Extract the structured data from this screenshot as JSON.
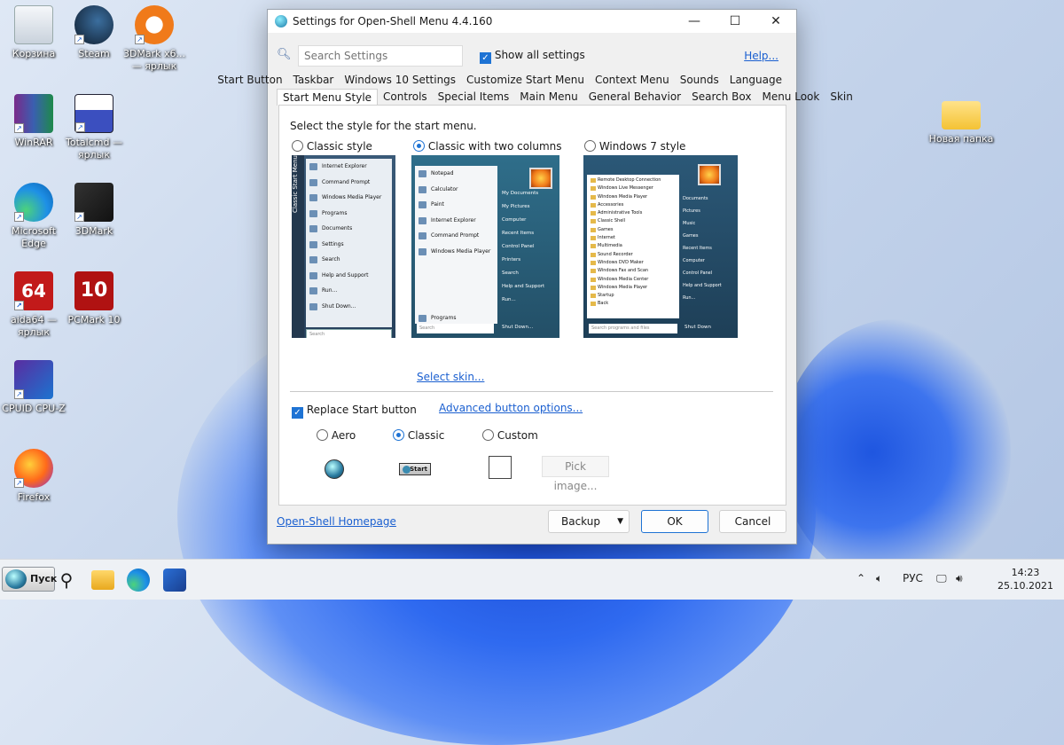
{
  "desktop": {
    "icons": [
      {
        "label": "Корзина"
      },
      {
        "label": "Steam"
      },
      {
        "label": "3DMark x6... — ярлык"
      },
      {
        "label": "WinRAR"
      },
      {
        "label": "Totalcmd — ярлык"
      },
      {
        "label": "Microsoft Edge"
      },
      {
        "label": "3DMark"
      },
      {
        "label": "aida64 — ярлык"
      },
      {
        "label": "PCMark 10"
      },
      {
        "label": "CPUID CPU-Z"
      },
      {
        "label": "Firefox"
      },
      {
        "label": "Новая папка"
      }
    ]
  },
  "window": {
    "title": "Settings for Open-Shell Menu 4.4.160",
    "search_placeholder": "Search Settings",
    "show_all_label": "Show all settings",
    "help_label": "Help...",
    "tabs_row1": [
      "Start Button",
      "Taskbar",
      "Windows 10 Settings",
      "Customize Start Menu",
      "Context Menu",
      "Sounds",
      "Language"
    ],
    "tabs_row2": [
      "Start Menu Style",
      "Controls",
      "Special Items",
      "Main Menu",
      "General Behavior",
      "Search Box",
      "Menu Look",
      "Skin"
    ],
    "select_label": "Select the style for the start menu.",
    "styles": [
      "Classic style",
      "Classic with two columns",
      "Windows 7 style"
    ],
    "preview_classic": {
      "side_text": "Classic Start Menu",
      "items": [
        "Internet Explorer",
        "Command Prompt",
        "Windows Media Player",
        "Programs",
        "Documents",
        "Settings",
        "Search",
        "Help and Support",
        "Run...",
        "Shut Down..."
      ],
      "search": "Search"
    },
    "preview_two_col": {
      "left": [
        "Notepad",
        "Calculator",
        "Paint",
        "Internet Explorer",
        "Command Prompt",
        "Windows Media Player"
      ],
      "programs": "Programs",
      "right": [
        "My Documents",
        "My Pictures",
        "Computer",
        "Recent Items",
        "Control Panel",
        "Printers",
        "Search",
        "Help and Support",
        "Run..."
      ],
      "search": "Search",
      "shutdown": "Shut Down..."
    },
    "preview_win7": {
      "left": [
        "Remote Desktop Connection",
        "Windows Live Messenger",
        "Windows Media Player",
        "Accessories",
        "Administrative Tools",
        "Classic Shell",
        "Games",
        "Internet",
        "Multimedia",
        "Sound Recorder",
        "Windows DVD Maker",
        "Windows Fax and Scan",
        "Windows Media Center",
        "Windows Media Player",
        "Startup",
        "Back"
      ],
      "right": [
        "Documents",
        "Pictures",
        "Music",
        "Games",
        "Recent Items",
        "Computer",
        "Control Panel",
        "Help and Support",
        "Run..."
      ],
      "search": "Search programs and files",
      "shutdown": "Shut Down"
    },
    "select_skin": "Select skin...",
    "replace_start_label": "Replace Start button",
    "advanced_options": "Advanced button options...",
    "button_styles": [
      "Aero",
      "Classic",
      "Custom"
    ],
    "classic_button_text": "Start",
    "pick_image": "Pick image...",
    "homepage": "Open-Shell Homepage",
    "backup": "Backup",
    "ok": "OK",
    "cancel": "Cancel"
  },
  "taskbar": {
    "start_label": "Пуск",
    "lang": "РУС",
    "time": "14:23",
    "date": "25.10.2021"
  }
}
